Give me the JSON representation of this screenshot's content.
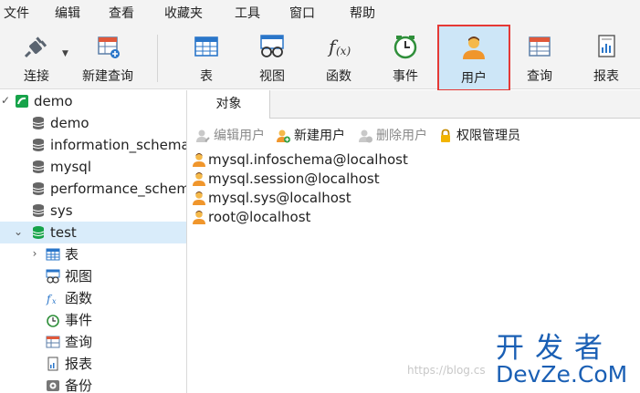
{
  "menu": [
    "文件",
    "编辑",
    "查看",
    "收藏夹",
    "工具",
    "窗口",
    "帮助"
  ],
  "toolbar": {
    "connect": "连接",
    "new_query": "新建查询",
    "table": "表",
    "view": "视图",
    "function": "函数",
    "event": "事件",
    "user": "用户",
    "query": "查询",
    "report": "报表"
  },
  "sidebar": {
    "connection": "demo",
    "databases": [
      "demo",
      "information_schema",
      "mysql",
      "performance_schema",
      "sys"
    ],
    "open_db": "test",
    "children": [
      "表",
      "视图",
      "函数",
      "事件",
      "查询",
      "报表",
      "备份"
    ]
  },
  "main": {
    "tab": "对象",
    "actions": {
      "edit_user": "编辑用户",
      "new_user": "新建用户",
      "delete_user": "删除用户",
      "privilege_manager": "权限管理员"
    },
    "users": [
      "mysql.infoschema@localhost",
      "mysql.session@localhost",
      "mysql.sys@localhost",
      "root@localhost"
    ]
  },
  "watermark": "https://blog.cs",
  "logo": {
    "line1": "开发者",
    "line2": "DevZe.CoM"
  },
  "colors": {
    "accent_blue": "#1a5fb4",
    "highlight_red": "#e53935",
    "selection": "#d9ecfa",
    "db_green": "#17a34a"
  }
}
